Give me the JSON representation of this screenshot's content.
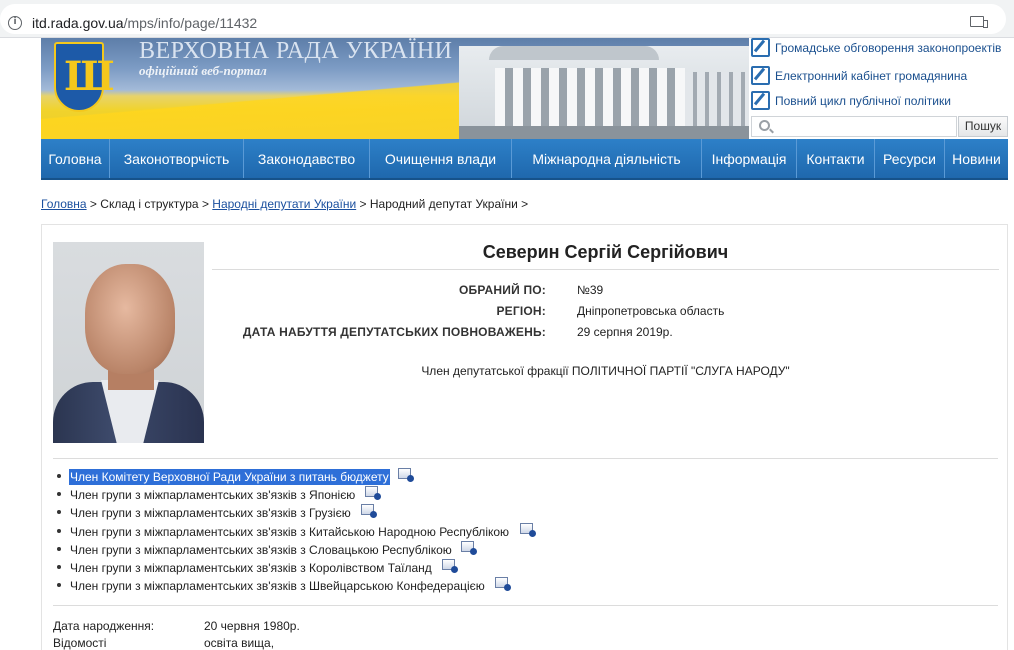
{
  "browser": {
    "url_host": "itd.rada.gov.ua",
    "url_path": "/mps/info/page/11432"
  },
  "header": {
    "title": "ВЕРХОВНА РАДА УКРАЇНИ",
    "subtitle": "офіційний веб-портал",
    "links": [
      "Громадське обговорення законопроектів",
      "Електронний кабінет громадянина",
      "Повний цикл публічної політики"
    ],
    "search_button": "Пошук",
    "search_value": ""
  },
  "nav": [
    "Головна",
    "Законотворчість",
    "Законодавство",
    "Очищення влади",
    "Міжнародна діяльність",
    "Інформація",
    "Контакти",
    "Ресурси",
    "Новини"
  ],
  "breadcrumb": {
    "home": "Головна",
    "sep": " > ",
    "structure": "Склад і структура",
    "deputies": "Народні депутати України",
    "current": "Народний депутат України",
    "tail": " >"
  },
  "deputy": {
    "name": "Северин Сергій Сергійович",
    "fields": [
      {
        "label": "ОБРАНИЙ ПО:",
        "value": "№39"
      },
      {
        "label": "РЕГІОН:",
        "value": "Дніпропетровська область"
      },
      {
        "label": "ДАТА НАБУТТЯ ДЕПУТАТСЬКИХ ПОВНОВАЖЕНЬ:",
        "value": "29 серпня 2019р."
      }
    ],
    "faction": "Член депутатської фракції ПОЛІТИЧНОЇ ПАРТІЇ \"СЛУГА НАРОДУ\""
  },
  "groups": [
    {
      "text": "Член Комітету Верховної Ради України з питань бюджету",
      "selected": true
    },
    {
      "text": "Член групи з міжпарламентських зв'язків з Японією",
      "selected": false
    },
    {
      "text": "Член групи з міжпарламентських зв'язків з Грузією",
      "selected": false
    },
    {
      "text": "Член групи з міжпарламентських зв'язків з Китайською Народною Республікою",
      "selected": false
    },
    {
      "text": "Член групи з міжпарламентських зв'язків з Словацькою Республікою",
      "selected": false
    },
    {
      "text": "Член групи з міжпарламентських зв'язків з Королівством Таїланд",
      "selected": false
    },
    {
      "text": "Член групи з міжпарламентських зв'язків з Швейцарською Конфедерацією",
      "selected": false
    }
  ],
  "bio": [
    {
      "label": "Дата народження:",
      "value": "20 червня 1980р."
    },
    {
      "label": "Відомості",
      "value": "освіта вища,"
    }
  ],
  "colors": {
    "nav_blue": "#2577bd",
    "link_blue": "#1a4f9e",
    "selection": "#2e6fd8"
  },
  "icons": {
    "group_doc": "document-card-icon",
    "header_link": "pencil-square-icon"
  }
}
